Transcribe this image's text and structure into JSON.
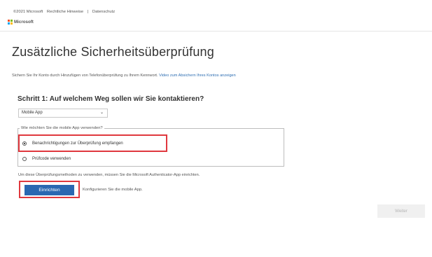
{
  "header": {
    "copyright": "©2021 Microsoft",
    "legal_link": "Rechtliche Hinweise",
    "separator": "|",
    "privacy_link": "Datenschutz",
    "logo_text": "Microsoft",
    "logo_colors": [
      "#f25022",
      "#7fba00",
      "#00a4ef",
      "#ffb900"
    ]
  },
  "page": {
    "title": "Zusätzliche Sicherheitsüberprüfung",
    "description": "Sichern Sie Ihr Konto durch Hinzufügen von Telefonüberprüfung zu Ihrem Kennwort.",
    "video_link": "Video zum Absichern Ihres Kontos anzeigen"
  },
  "step": {
    "heading": "Schritt 1: Auf welchem Weg sollen wir Sie kontaktieren?",
    "method_select": {
      "value": "Mobile App",
      "icon": "chevron-down-icon"
    }
  },
  "usage": {
    "legend": "Wie möchten Sie die mobile App verwenden?",
    "options": [
      {
        "label": "Benachrichtigungen zur Überprüfung empfangen",
        "checked": true
      },
      {
        "label": "Prüfcode verwenden",
        "checked": false
      }
    ]
  },
  "setup": {
    "info": "Um diese Überprüfungsmethoden zu verwenden, müssen Sie die Microsoft Authenticator-App einrichten.",
    "button_label": "Einrichten",
    "configure_text": "Konfigurieren Sie die mobile App."
  },
  "footer": {
    "next_label": "Weiter"
  },
  "colors": {
    "accent": "#2a67b1",
    "highlight": "#e0383e",
    "link": "#2f6fb3"
  }
}
